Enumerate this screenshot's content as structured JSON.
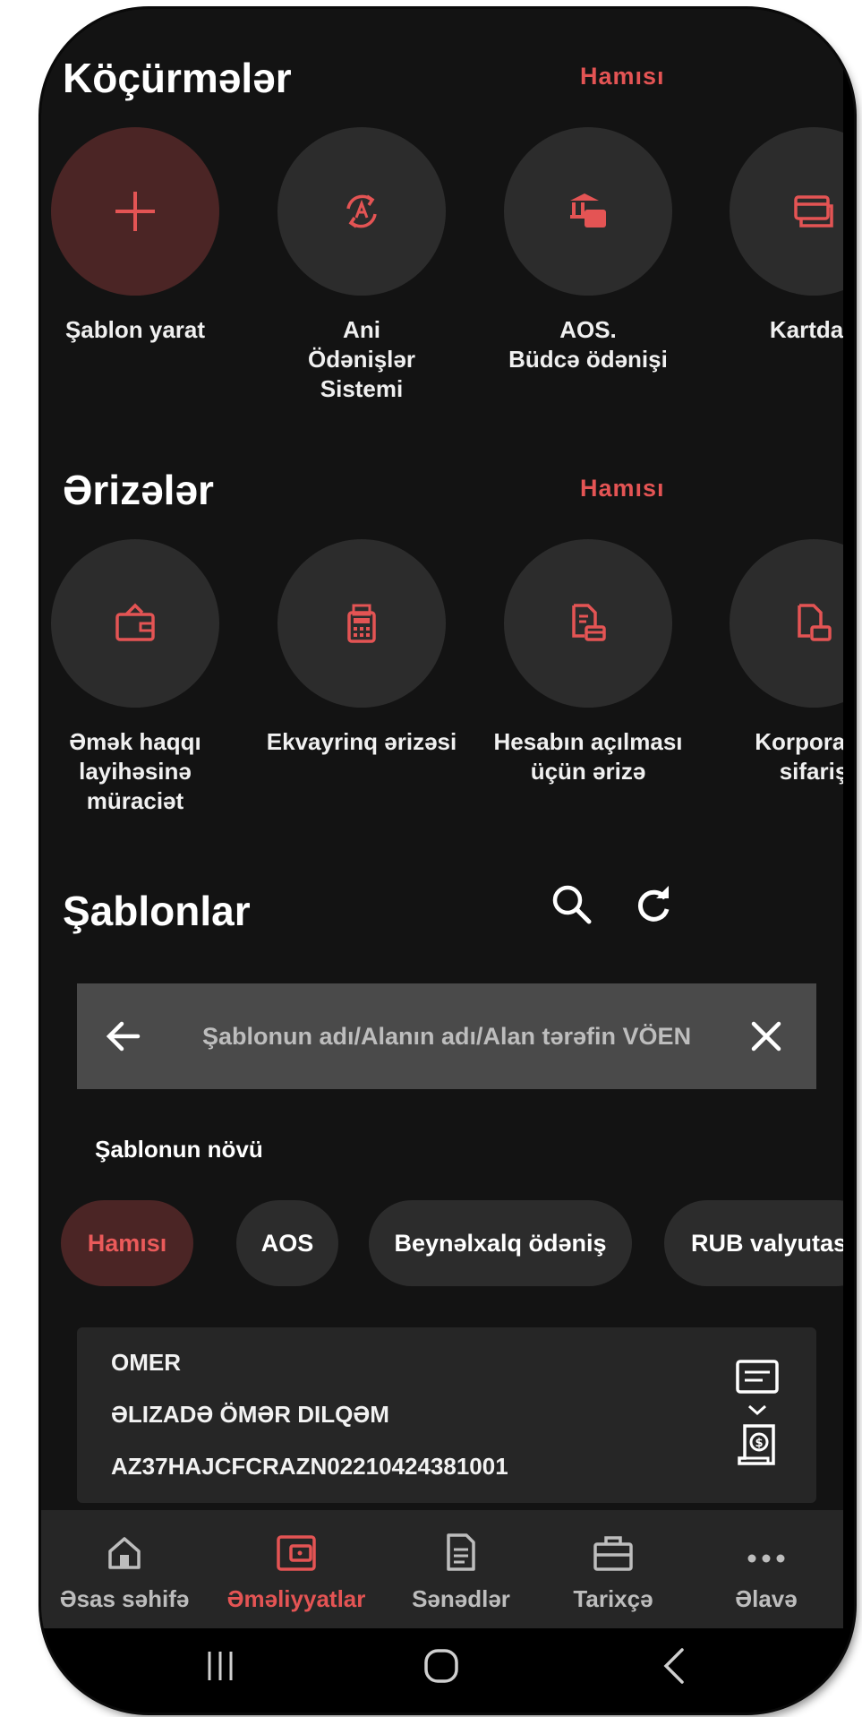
{
  "colors": {
    "accent": "#e45454",
    "background": "#131313",
    "surface": "#2c2c2c",
    "accent_surface": "#4b2525"
  },
  "transfers": {
    "title": "Köçürmələr",
    "see_all": "Hamısı",
    "items": [
      {
        "label": "Şablon yarat",
        "icon": "plus-icon"
      },
      {
        "label": "Ani\nÖdənişlər\nSistemi",
        "icon": "instant-payment-icon"
      },
      {
        "label": "AOS.\nBüdcə ödənişi",
        "icon": "budget-payment-icon"
      },
      {
        "label": "Kartdan",
        "icon": "card-icon"
      }
    ]
  },
  "applications": {
    "title": "Ərizələr",
    "see_all": "Hamısı",
    "items": [
      {
        "label": "Əmək haqqı\nlayihəsinə\nmüraciət",
        "icon": "wallet-icon"
      },
      {
        "label": "Ekvayrinq ərizəsi",
        "icon": "pos-terminal-icon"
      },
      {
        "label": "Hesabın açılması\nüçün ərizə",
        "icon": "document-card-icon"
      },
      {
        "label": "Korporativ\nsifariş",
        "icon": "document-icon"
      }
    ]
  },
  "templates": {
    "title": "Şablonlar",
    "search_placeholder": "Şablonun adı/Alanın adı/Alan tərəfin VÖEN",
    "filter_label": "Şablonun növü",
    "chips": [
      "Hamısı",
      "AOS",
      "Beynəlxalq ödəniş",
      "RUB valyutası"
    ],
    "active_chip": 0,
    "card": {
      "name": "OMER",
      "recipient": "ƏLIZADƏ ÖMƏR DILQƏM",
      "iban": "AZ37HAJCFCRAZN02210424381001"
    }
  },
  "bottom_nav": {
    "items": [
      {
        "label": "Əsas səhifə",
        "icon": "home-icon"
      },
      {
        "label": "Əməliyyatlar",
        "icon": "wallet-card-icon"
      },
      {
        "label": "Sənədlər",
        "icon": "document-icon"
      },
      {
        "label": "Tarixçə",
        "icon": "briefcase-icon"
      },
      {
        "label": "Əlavə",
        "icon": "more-icon"
      }
    ],
    "active_index": 1
  }
}
